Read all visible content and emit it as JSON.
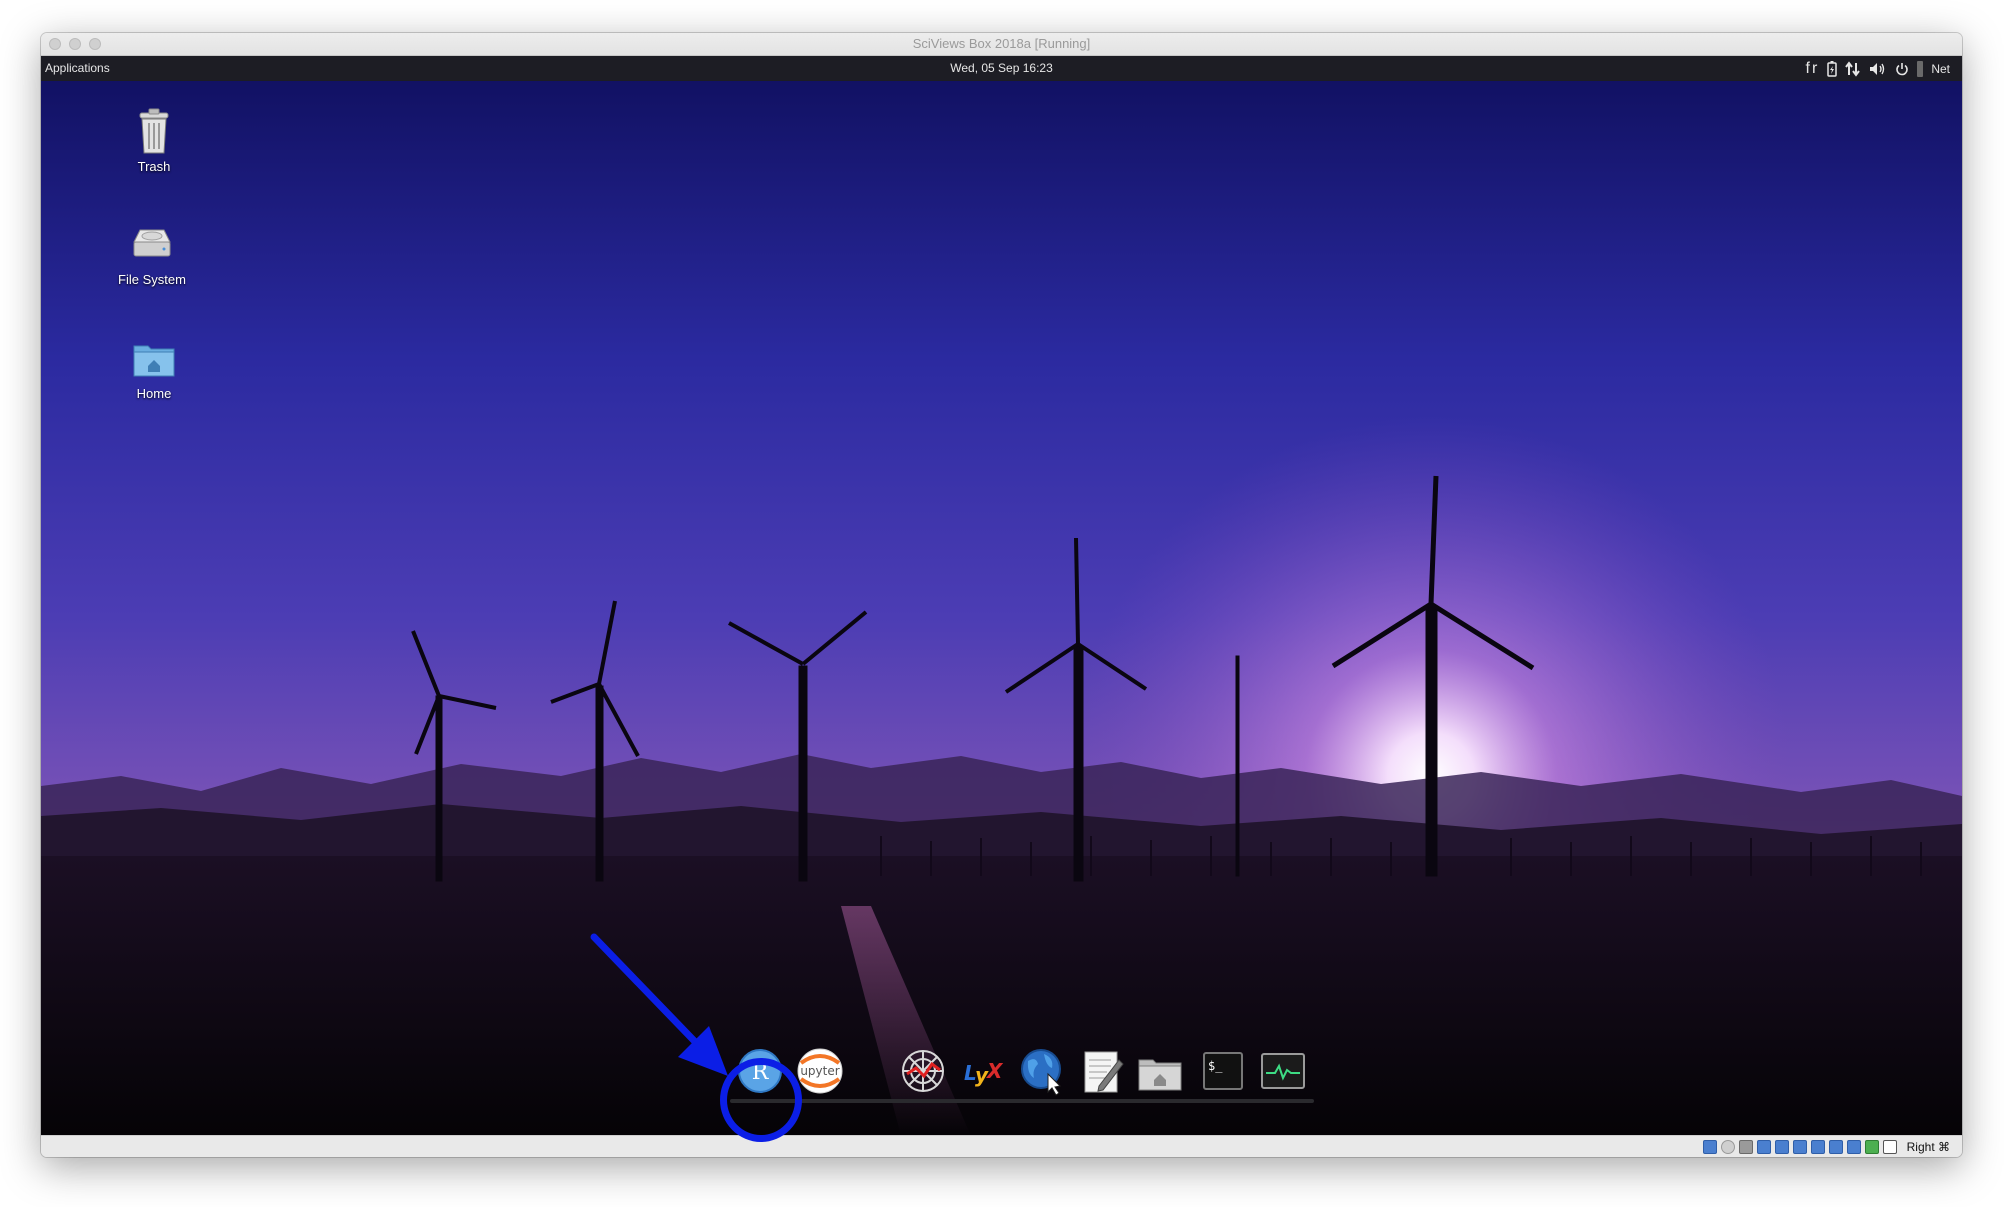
{
  "host_window": {
    "title": "SciViews Box 2018a [Running]"
  },
  "top_panel": {
    "applications_label": "Applications",
    "clock": "Wed, 05 Sep  16:23",
    "keyboard_layout": "fr",
    "network_label": "Net"
  },
  "desktop": {
    "icons": [
      {
        "label": "Trash",
        "icon": "trash-icon"
      },
      {
        "label": "File System",
        "icon": "drive-icon"
      },
      {
        "label": "Home",
        "icon": "home-folder-icon"
      }
    ]
  },
  "dock": {
    "items": [
      {
        "name": "rstudio",
        "icon": "r-icon",
        "glyph": "R"
      },
      {
        "name": "jupyter",
        "icon": "jupyter-icon",
        "glyph": "upyter"
      },
      {
        "name": "zotero-web",
        "icon": "web-icon"
      },
      {
        "name": "lyx",
        "icon": "lyx-icon",
        "glyph": "LyX"
      },
      {
        "name": "web-browser",
        "icon": "globe-icon"
      },
      {
        "name": "text-editor",
        "icon": "text-editor-icon"
      },
      {
        "name": "file-manager",
        "icon": "home-folder-icon"
      },
      {
        "name": "terminal",
        "icon": "terminal-icon",
        "glyph": "$_"
      },
      {
        "name": "task-manager",
        "icon": "activity-monitor-icon"
      }
    ]
  },
  "status_bar": {
    "host_key": "Right ⌘"
  },
  "colors": {
    "annotation_blue": "#0b1ee6",
    "panel": "#1d1d24",
    "sky_top": "#14146b",
    "sky_mid": "#5b45b8",
    "sunset": "#d9a0e8"
  }
}
